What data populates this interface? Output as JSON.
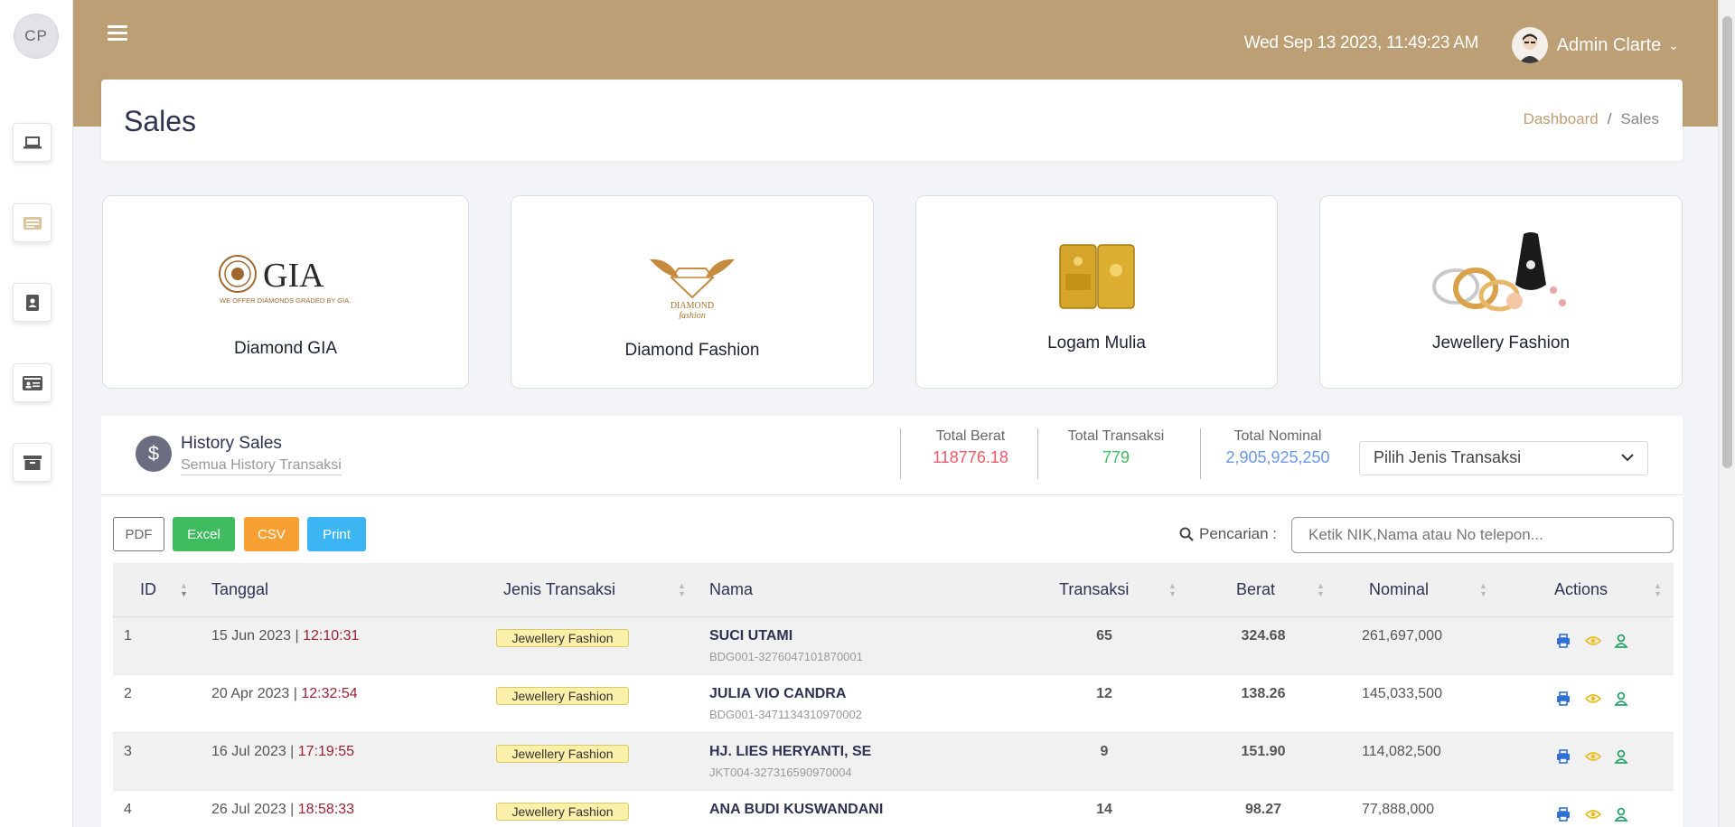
{
  "sidebar": {
    "avatar_initials": "CP",
    "icons": [
      "laptop-icon",
      "list-icon",
      "contact-book-icon",
      "id-card-icon",
      "archive-icon"
    ]
  },
  "header": {
    "datetime": "Wed Sep 13 2023, 11:49:23 AM",
    "user_name": "Admin Clarte"
  },
  "page": {
    "title": "Sales",
    "breadcrumb": [
      "Dashboard",
      "Sales"
    ]
  },
  "categories": [
    {
      "label": "Diamond GIA",
      "logo_text": "GIA",
      "logo_tagline": "WE OFFER DIAMONDS GRADED BY GIA."
    },
    {
      "label": "Diamond Fashion",
      "logo_text": "DIAMOND",
      "logo_tagline": "fashion"
    },
    {
      "label": "Logam Mulia"
    },
    {
      "label": "Jewellery Fashion"
    }
  ],
  "history": {
    "title": "History Sales",
    "subtitle": "Semua History Transaksi",
    "stats": {
      "berat_label": "Total Berat",
      "berat_value": "118776.18",
      "transaksi_label": "Total Transaksi",
      "transaksi_value": "779",
      "nominal_label": "Total Nominal",
      "nominal_value": "2,905,925,250"
    },
    "select_placeholder": "Pilih Jenis Transaksi",
    "buttons": {
      "pdf": "PDF",
      "excel": "Excel",
      "csv": "CSV",
      "print": "Print"
    },
    "search_label": "Pencarian :",
    "search_placeholder": "Ketik NIK,Nama atau No telepon...",
    "columns": [
      "ID",
      "Tanggal",
      "Jenis Transaksi",
      "Nama",
      "Transaksi",
      "Berat",
      "Nominal",
      "Actions"
    ],
    "rows": [
      {
        "id": "1",
        "date": "15 Jun 2023",
        "time": "12:10:31",
        "jenis": "Jewellery Fashion",
        "nama": "SUCI UTAMI",
        "nik": "BDG001-3276047101870001",
        "transaksi": "65",
        "berat": "324.68",
        "nominal": "261,697,000"
      },
      {
        "id": "2",
        "date": "20 Apr 2023",
        "time": "12:32:54",
        "jenis": "Jewellery Fashion",
        "nama": "JULIA VIO CANDRA",
        "nik": "BDG001-3471134310970002",
        "transaksi": "12",
        "berat": "138.26",
        "nominal": "145,033,500"
      },
      {
        "id": "3",
        "date": "16 Jul 2023",
        "time": "17:19:55",
        "jenis": "Jewellery Fashion",
        "nama": "HJ. LIES HERYANTI, SE",
        "nik": "JKT004-327316590970004",
        "transaksi": "9",
        "berat": "151.90",
        "nominal": "114,082,500"
      },
      {
        "id": "4",
        "date": "26 Jul 2023",
        "time": "18:58:33",
        "jenis": "Jewellery Fashion",
        "nama": "ANA BUDI KUSWANDANI",
        "nik": "",
        "transaksi": "14",
        "berat": "98.27",
        "nominal": "77,888,000"
      }
    ]
  },
  "colors": {
    "brand": "#bd9f76",
    "berat": "#f05a6a",
    "transaksi": "#3fbd5e",
    "nominal": "#6c97e6",
    "time": "#9b2233"
  }
}
